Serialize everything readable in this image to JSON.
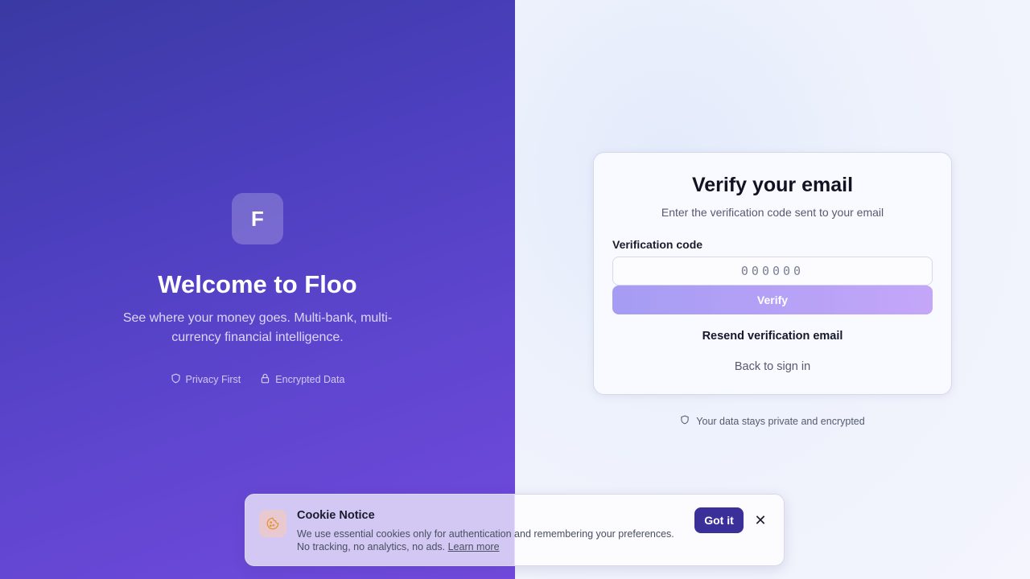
{
  "brand": {
    "logo_letter": "F",
    "welcome_title": "Welcome to Floo",
    "subtitle": "See where your money goes. Multi-bank, multi-currency financial intelligence.",
    "features": [
      {
        "icon": "shield-icon",
        "label": "Privacy First"
      },
      {
        "icon": "lock-icon",
        "label": "Encrypted Data"
      }
    ]
  },
  "verify_card": {
    "title": "Verify your email",
    "subtitle": "Enter the verification code sent to your email",
    "code_label": "Verification code",
    "code_placeholder": "000000",
    "code_value": "",
    "verify_label": "Verify",
    "resend_label": "Resend verification email",
    "back_label": "Back to sign in"
  },
  "privacy_note": {
    "icon": "shield-icon",
    "text": "Your data stays private and encrypted"
  },
  "cookie_notice": {
    "icon": "cookie-icon",
    "title": "Cookie Notice",
    "text": "We use essential cookies only for authentication and remembering your preferences. No tracking, no analytics, no ads.",
    "learn_more": "Learn more",
    "accept_label": "Got it",
    "close_symbol": "✕"
  },
  "colors": {
    "brand_gradient_start": "#3a3aa3",
    "brand_gradient_end": "#7249de",
    "verify_button": "#a59cf4",
    "accept_button": "#3b2f9a",
    "cookie_icon": "#e8943a"
  }
}
